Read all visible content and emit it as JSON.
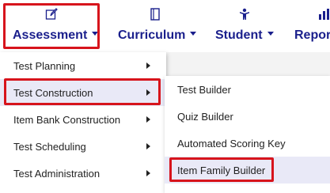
{
  "topnav": {
    "items": [
      {
        "label": "Assessment",
        "icon": "edit-icon"
      },
      {
        "label": "Curriculum",
        "icon": "notebook-icon"
      },
      {
        "label": "Student",
        "icon": "student-icon"
      },
      {
        "label": "Repor",
        "icon": "chart-icon"
      }
    ]
  },
  "menu_level1": {
    "items": [
      {
        "label": "Test Planning"
      },
      {
        "label": "Test Construction"
      },
      {
        "label": "Item Bank Construction"
      },
      {
        "label": "Test Scheduling"
      },
      {
        "label": "Test Administration"
      }
    ]
  },
  "menu_level2": {
    "items": [
      {
        "label": "Test Builder"
      },
      {
        "label": "Quiz Builder"
      },
      {
        "label": "Automated Scoring Key"
      },
      {
        "label": "Item Family Builder"
      }
    ]
  },
  "colors": {
    "nav_text": "#1a1f8c",
    "highlight_border": "#d7141c",
    "active_item_bg": "#e9e9f7",
    "page_bg": "#f3f3f3"
  }
}
